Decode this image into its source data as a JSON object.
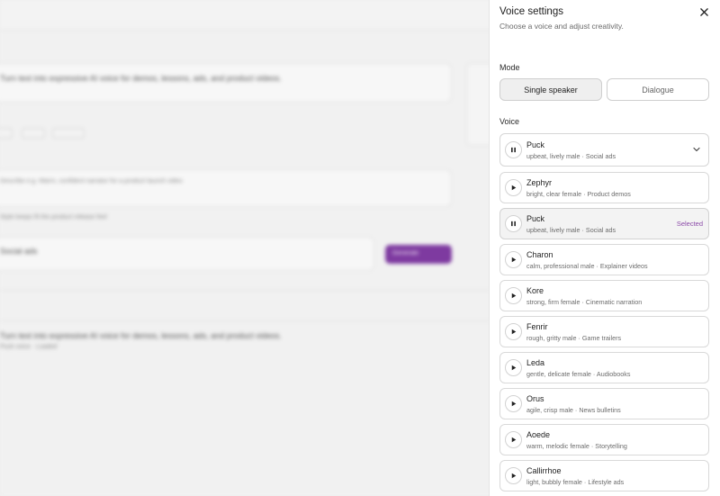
{
  "drawer": {
    "title": "Voice settings",
    "subtitle": "Choose a voice and adjust creativity.",
    "mode_label": "Mode",
    "mode_options": [
      "Single speaker",
      "Dialogue"
    ],
    "mode_selected": "Single speaker",
    "voice_label": "Voice",
    "current_voice": {
      "name": "Puck",
      "desc": "upbeat, lively male · Social ads",
      "state": "playing"
    },
    "selected_tag": "Selected",
    "voices": [
      {
        "name": "Zephyr",
        "desc": "bright, clear female · Product demos",
        "icon": "play-icon"
      },
      {
        "name": "Puck",
        "desc": "upbeat, lively male · Social ads",
        "icon": "pause-icon",
        "selected": true
      },
      {
        "name": "Charon",
        "desc": "calm, professional male · Explainer videos",
        "icon": "play-icon"
      },
      {
        "name": "Kore",
        "desc": "strong, firm female · Cinematic narration",
        "icon": "play-icon"
      },
      {
        "name": "Fenrir",
        "desc": "rough, gritty male · Game trailers",
        "icon": "play-icon"
      },
      {
        "name": "Leda",
        "desc": "gentle, delicate female · Audiobooks",
        "icon": "play-icon"
      },
      {
        "name": "Orus",
        "desc": "agile, crisp male · News bulletins",
        "icon": "play-icon"
      },
      {
        "name": "Aoede",
        "desc": "warm, melodic female · Storytelling",
        "icon": "play-icon"
      },
      {
        "name": "Callirrhoe",
        "desc": "light, bubbly female · Lifestyle ads",
        "icon": "play-icon"
      }
    ]
  },
  "colors": {
    "accent": "#8b4aa8",
    "generate_button": "#7e3aa0"
  }
}
